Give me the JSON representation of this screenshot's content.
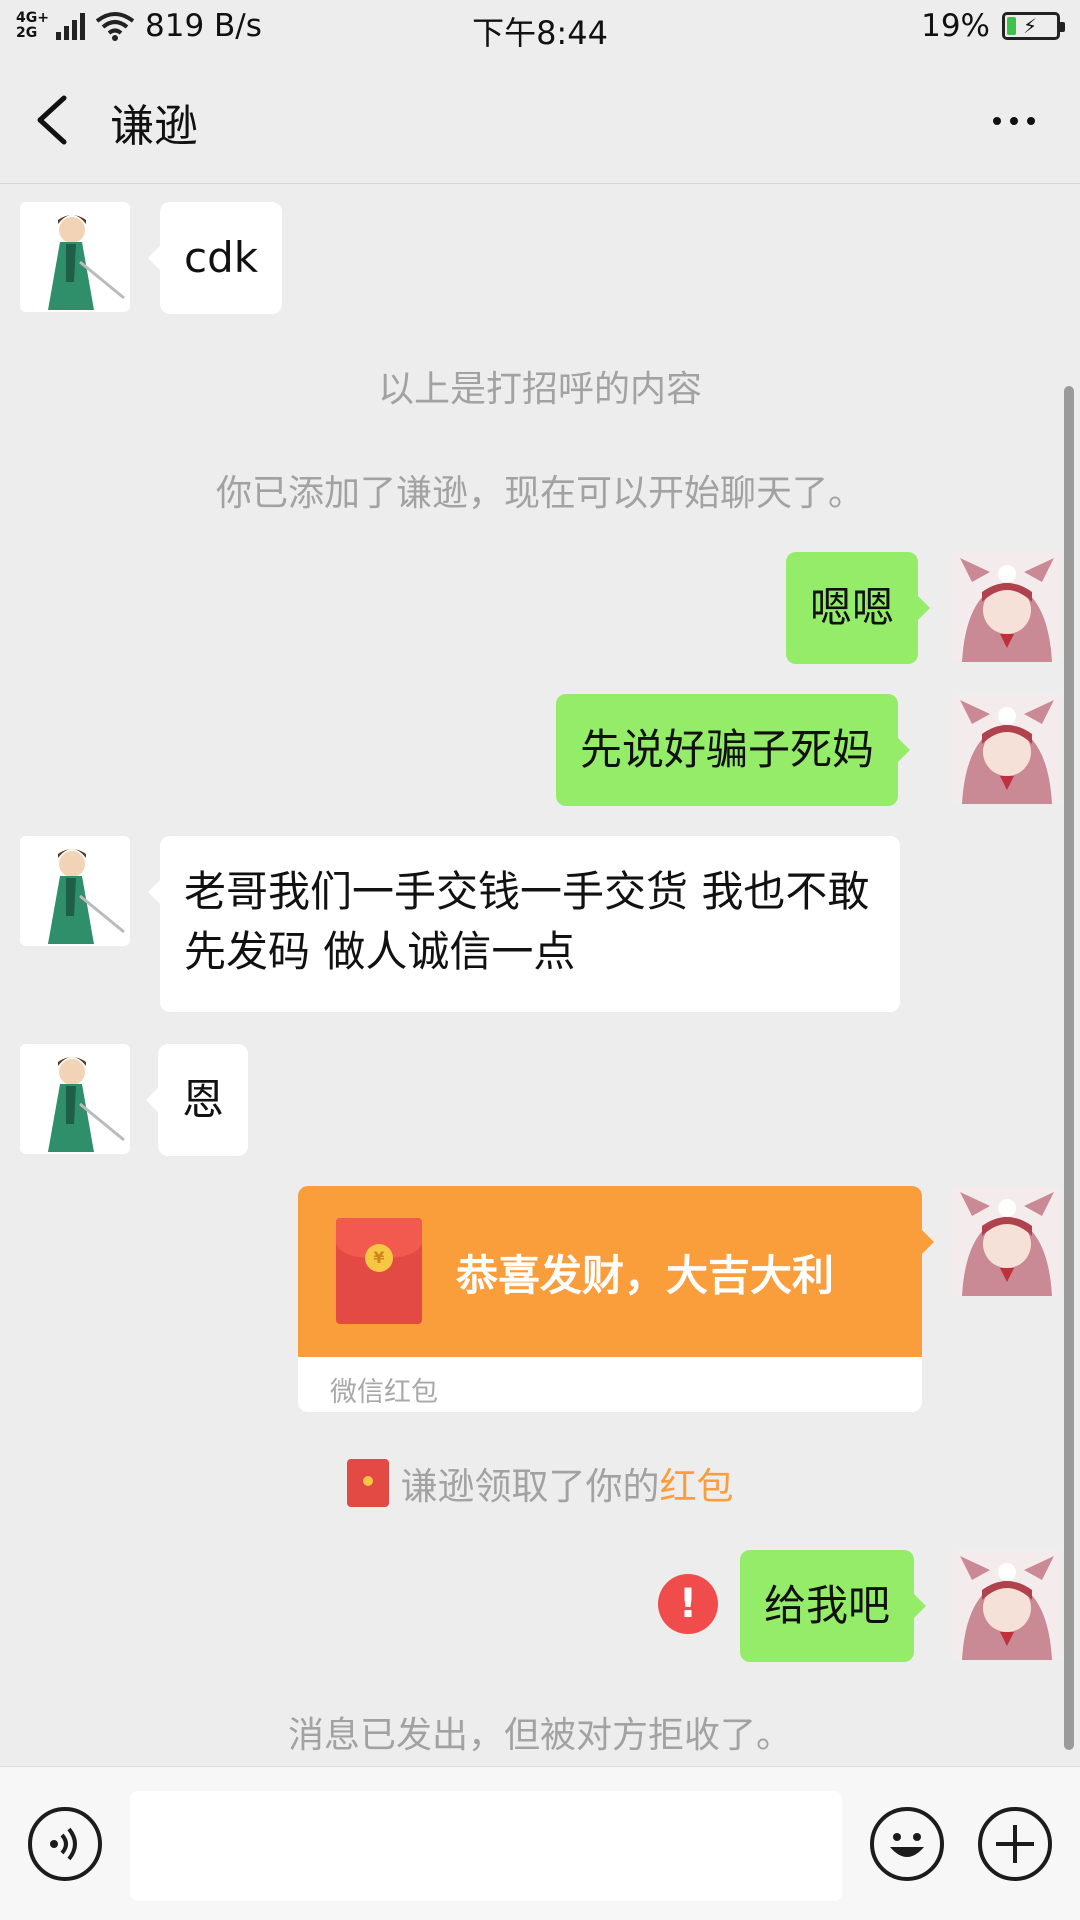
{
  "status_bar": {
    "network_type": "4G+ 2G",
    "speed": "819 B/s",
    "time": "下午8:44",
    "battery_percent": "19%",
    "battery_level": 0.19,
    "battery_color": "#3ec34a"
  },
  "header": {
    "title": "谦逊",
    "back_icon": "chevron-left-icon",
    "more_icon": "more-dots-icon"
  },
  "messages": [
    {
      "side": "left",
      "text": "cdk"
    },
    {
      "type": "system",
      "text": "以上是打招呼的内容"
    },
    {
      "type": "system",
      "text": "你已添加了谦逊，现在可以开始聊天了。"
    },
    {
      "side": "right",
      "text": "嗯嗯"
    },
    {
      "side": "right",
      "text": "先说好骗子死妈"
    },
    {
      "side": "left",
      "text": "老哥我们一手交钱一手交货  我也不敢先发码   做人诚信一点"
    },
    {
      "side": "left",
      "text": "恩"
    },
    {
      "side": "right",
      "type": "red_packet",
      "title": "恭喜发财，大吉大利",
      "footer": "微信红包"
    },
    {
      "type": "system_red_packet",
      "text": "谦逊领取了你的",
      "link": "红包"
    },
    {
      "side": "right",
      "text": "给我吧",
      "status": "failed"
    },
    {
      "type": "system",
      "text": "消息已发出，但被对方拒收了。"
    }
  ],
  "input_bar": {
    "value": "",
    "voice_icon": "voice-icon",
    "emoji_icon": "emoji-icon",
    "plus_icon": "plus-icon"
  },
  "colors": {
    "background": "#ededed",
    "self_bubble": "#95ec69",
    "other_bubble": "#ffffff",
    "red_packet": "#fa9d3b",
    "error": "#f04c4c"
  }
}
